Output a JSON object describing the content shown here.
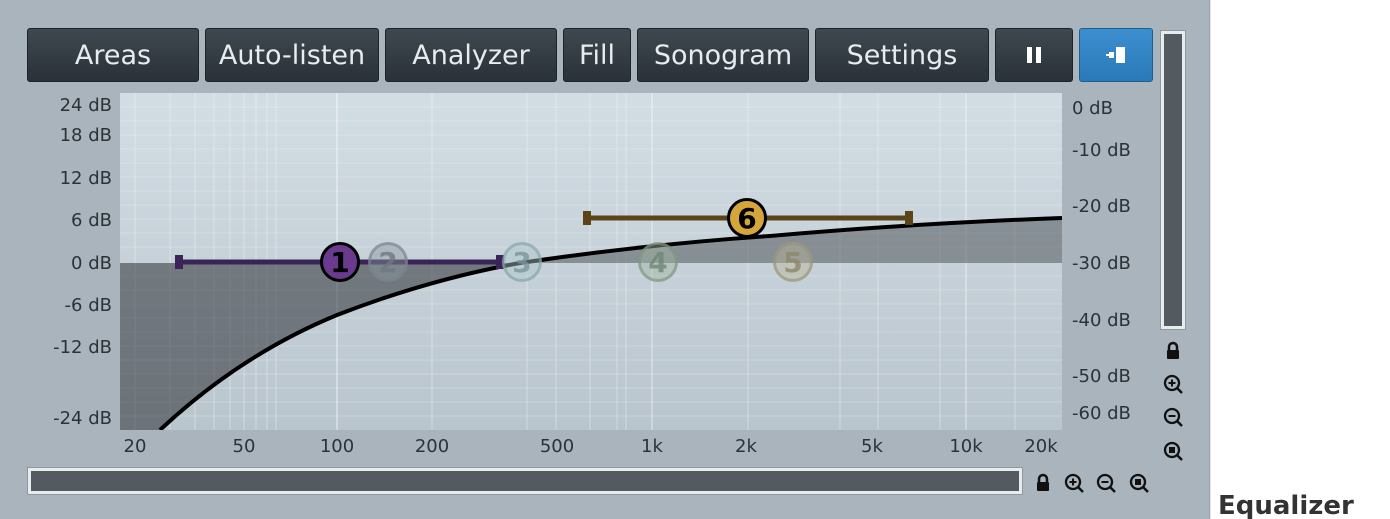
{
  "toolbar": {
    "buttons": [
      {
        "label": "Areas"
      },
      {
        "label": "Auto-listen"
      },
      {
        "label": "Analyzer"
      },
      {
        "label": "Fill"
      },
      {
        "label": "Sonogram"
      },
      {
        "label": "Settings"
      }
    ],
    "pause_icon": "pause-icon",
    "view_toggle_icon": "panel-toggle-icon",
    "accent_color": "#2f82c4"
  },
  "graph": {
    "gain_axis_labels": [
      "24 dB",
      "18 dB",
      "12 dB",
      "6 dB",
      "0 dB",
      "-6 dB",
      "-12 dB",
      "-24 dB"
    ],
    "spectrum_axis_labels": [
      "0 dB",
      "-10 dB",
      "-20 dB",
      "-30 dB",
      "-40 dB",
      "-50 dB",
      "-60 dB"
    ],
    "freq_axis_labels": [
      "20",
      "50",
      "100",
      "200",
      "500",
      "1k",
      "2k",
      "5k",
      "10k",
      "20k"
    ],
    "bands": [
      {
        "label": "1",
        "state": "selected",
        "color": "#6a3a8f"
      },
      {
        "label": "2",
        "state": "inactive"
      },
      {
        "label": "3",
        "state": "inactive"
      },
      {
        "label": "4",
        "state": "inactive"
      },
      {
        "label": "5",
        "state": "inactive"
      },
      {
        "label": "6",
        "state": "active",
        "color": "#d4a53b"
      }
    ]
  },
  "controls": {
    "lock_icon": "lock-icon",
    "zoom_in_icon": "zoom-in-icon",
    "zoom_out_icon": "zoom-out-icon",
    "zoom_fit_icon": "zoom-fit-icon"
  },
  "sidebar": {
    "title": "Equalizer"
  }
}
